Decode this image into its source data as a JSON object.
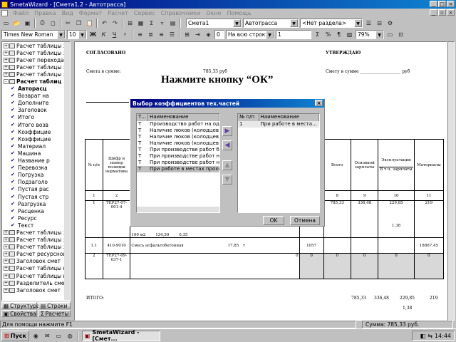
{
  "window": {
    "title": "SmetaWizard - [Смета1.2 - Автотрасса]"
  },
  "menu": [
    "Файл",
    "Правка",
    "Вид",
    "Формат",
    "Расчет",
    "Сервис",
    "Справочники",
    "Окно",
    "Помощь"
  ],
  "toolbar": {
    "font": "Times New Roman",
    "size": "10",
    "bold": "Ж",
    "italic": "К",
    "underline": "Ч",
    "zero_value": "0",
    "row_mode": "На всю строку",
    "one_value": "1",
    "smeta": "Смета1",
    "road": "Автотрасса",
    "section": "<Нет раздела>",
    "zoom": "79%"
  },
  "tree": [
    {
      "text": "Расчет таблицы за",
      "lvl": 0,
      "icon": "doc"
    },
    {
      "text": "Расчет таблицы за",
      "lvl": 0,
      "icon": "doc"
    },
    {
      "text": "Расчет перехода в",
      "lvl": 0,
      "icon": "doc"
    },
    {
      "text": "Расчет таблицы за",
      "lvl": 0,
      "icon": "doc"
    },
    {
      "text": "Расчет таблицы за",
      "lvl": 0,
      "icon": "doc"
    },
    {
      "text": "Расчет таблиц",
      "lvl": 0,
      "icon": "doc",
      "bold": true,
      "plus": "-"
    },
    {
      "text": "Авторасц",
      "lvl": 1,
      "icon": "chk",
      "bold": true
    },
    {
      "text": "Возврат на",
      "lvl": 1,
      "icon": "chk"
    },
    {
      "text": "Дополните",
      "lvl": 1,
      "icon": "chk"
    },
    {
      "text": "Заголовок",
      "lvl": 1,
      "icon": "chk"
    },
    {
      "text": "Итого",
      "lvl": 1,
      "icon": "chk"
    },
    {
      "text": "Итого возв",
      "lvl": 1,
      "icon": "chk"
    },
    {
      "text": "Коэффицие",
      "lvl": 1,
      "icon": "chk"
    },
    {
      "text": "Коэффицие",
      "lvl": 1,
      "icon": "chk"
    },
    {
      "text": "Материал",
      "lvl": 1,
      "icon": "chk"
    },
    {
      "text": "Машина",
      "lvl": 1,
      "icon": "chk"
    },
    {
      "text": "Название р",
      "lvl": 1,
      "icon": "chk"
    },
    {
      "text": "Перевозка",
      "lvl": 1,
      "icon": "chk"
    },
    {
      "text": "Погрузка",
      "lvl": 1,
      "icon": "chk"
    },
    {
      "text": "Подзаголо",
      "lvl": 1,
      "icon": "chk"
    },
    {
      "text": "Пустая рас",
      "lvl": 1,
      "icon": "chk"
    },
    {
      "text": "Пустая стр",
      "lvl": 1,
      "icon": "chk"
    },
    {
      "text": "Разгрузка",
      "lvl": 1,
      "icon": "chk"
    },
    {
      "text": "Расценка",
      "lvl": 1,
      "icon": "chk"
    },
    {
      "text": "Ресурс",
      "lvl": 1,
      "icon": "chk"
    },
    {
      "text": "Текст",
      "lvl": 1,
      "icon": "chk"
    },
    {
      "text": "Расчет таблицы за",
      "lvl": 0,
      "icon": "doc"
    },
    {
      "text": "Расчет таблицы за",
      "lvl": 0,
      "icon": "doc"
    },
    {
      "text": "Расчет таблицы за",
      "lvl": 0,
      "icon": "doc"
    },
    {
      "text": "Расчет ресурсной",
      "lvl": 0,
      "icon": "doc"
    },
    {
      "text": "Заголовок смет",
      "lvl": 0,
      "icon": "doc"
    },
    {
      "text": "Расчет таблицы на",
      "lvl": 0,
      "icon": "doc"
    },
    {
      "text": "Расчет таблицы на",
      "lvl": 0,
      "icon": "doc"
    },
    {
      "text": "Разделитель смет",
      "lvl": 0,
      "icon": "doc"
    },
    {
      "text": "Заголовок смет",
      "lvl": 0,
      "icon": "doc"
    }
  ],
  "tabs": {
    "structure": "Структура",
    "rows": "Строки",
    "properties": "Свойства",
    "calculations": "Расчеты"
  },
  "document": {
    "agreed": "СОГЛАСОВАНО",
    "approve": "УТВЕРЖДАЮ",
    "sum_left": "Смета в сумме:",
    "sum_left_val": "785,33 руб",
    "sum_right": "Смету в сумме ___________________ руб",
    "overlay": "Нажмите кнопку “ОК”",
    "col_np": "№ п/п",
    "col_code": "Шифр и номер позиции норматива",
    "col_total_cost": "Общая стоимость, руб.",
    "col_all": "Всего",
    "col_wages": "Основной зарплаты",
    "col_exploit": "Эксплуатации",
    "col_incl_wages": "В т.ч. зарплаты",
    "col_mach": "Материалы",
    "nums": [
      "1",
      "2",
      "7",
      "8",
      "9",
      "10",
      "11"
    ],
    "r1_np": "1",
    "r1_code": "ТЕР27-07-001-4",
    "r1_vals": [
      "87,6",
      "785,33",
      "336,48",
      "229,85",
      "219"
    ],
    "r1_extra": "1,38",
    "r1_qty": "100 м2",
    "r1_a": "134,59",
    "r1_b": "0,35",
    "r2_np": "1.1",
    "r2_code": "410-9010",
    "r2_name": "Смесь асфальтобетонная",
    "r2_a": "17,85",
    "r2_t": "т",
    "r2_c": "1057",
    "r2_d": "18867,45",
    "r3_np": "2",
    "r3_code": "ТЕР27-09-037-1",
    "zero": "0",
    "total_label": "ИТОГО:",
    "total_vals": [
      "785,33",
      "336,48",
      "229,85",
      "219"
    ],
    "total_extra": "1,38"
  },
  "dialog": {
    "title": "Выбор коэффициентов тех.частей",
    "left_headers": [
      "Т...",
      "Наименование"
    ],
    "left_rows": [
      {
        "t": "Т",
        "name": "Производство работ на одно"
      },
      {
        "t": "Т",
        "name": "Наличие люков (колодцев) по"
      },
      {
        "t": "Т",
        "name": "Наличие люков (колодцев) по"
      },
      {
        "t": "Т",
        "name": "Наличие люков (колодцев) по"
      },
      {
        "t": "Т",
        "name": "При производстве работ без"
      },
      {
        "t": "Т",
        "name": "При производстве работ на в"
      },
      {
        "t": "Т",
        "name": "При производстве работ на в"
      },
      {
        "t": "Т",
        "name": "При работе в местах проходо"
      }
    ],
    "right_headers": [
      "№ п/п",
      "Наименование"
    ],
    "right_rows": [
      {
        "t": "1",
        "name": "При работе в места..."
      }
    ],
    "ok": "OK",
    "cancel": "Отмена"
  },
  "status": {
    "help": "Для помощи нажмите F1",
    "sum": "Сумма: 785,33 руб."
  },
  "taskbar": {
    "start": "Пуск",
    "app": "SmetaWizard - [Смет...",
    "clock": "14:44"
  }
}
